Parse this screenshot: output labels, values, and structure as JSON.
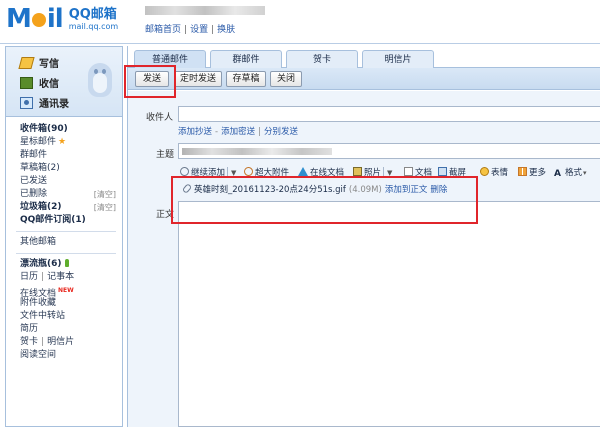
{
  "header": {
    "logo_m": "M",
    "logo_il": "il",
    "logo_cn": "QQ邮箱",
    "logo_domain": "mail.qq.com",
    "links": [
      "邮箱首页",
      "设置",
      "换肤"
    ],
    "link_sep": "|"
  },
  "sidebar": {
    "compose": [
      {
        "label": "写信",
        "icon": "pen-icon"
      },
      {
        "label": "收信",
        "icon": "inbox-icon"
      },
      {
        "label": "通讯录",
        "icon": "contacts-icon"
      }
    ],
    "folders": {
      "inbox": "收件箱(90)",
      "starred": "星标邮件",
      "group": "群邮件",
      "drafts": "草稿箱(2)",
      "sent": "已发送",
      "deleted": "已删除",
      "deleted_clear": "[清空]",
      "spam": "垃圾箱(2)",
      "spam_clear": "[清空]",
      "subscriptions": "QQ邮件订阅(1)",
      "other": "其他邮箱",
      "drift": "漂流瓶(6)",
      "calendar": "日历",
      "notes": "记事本",
      "docs": "在线文档",
      "docs_badge": "NEW",
      "favorites": "附件收藏",
      "transfer": "文件中转站",
      "resume": "简历",
      "greeting": "贺卡",
      "postcard": "明信片",
      "reading": "阅读空间"
    }
  },
  "tabs": [
    {
      "label": "普通邮件",
      "active": true
    },
    {
      "label": "群邮件",
      "active": false
    },
    {
      "label": "贺卡",
      "active": false
    },
    {
      "label": "明信片",
      "active": false
    }
  ],
  "toolbar": {
    "send": "发送",
    "schedule": "定时发送",
    "draft": "存草稿",
    "close": "关闭"
  },
  "form": {
    "to_label": "收件人",
    "to_value": "",
    "cc_links": [
      "添加抄送",
      "添加密送",
      "分别发送"
    ],
    "cc_sep1": "-",
    "cc_sep2": "|",
    "subject_label": "主题",
    "body_label": "正文"
  },
  "editor": {
    "attach": "继续添加",
    "big_attach": "超大附件",
    "online_doc": "在线文档",
    "photo": "照片",
    "document": "文档",
    "screenshot": "截屏",
    "emoji": "表情",
    "more": "更多",
    "format": "格式"
  },
  "attachment": {
    "filename": "英雄时刻_20161123-20点24分51s.gif",
    "size": "(4.09M)",
    "add_to_body": "添加到正文",
    "delete": "删除"
  },
  "colors": {
    "brand_blue": "#1e73c9",
    "annotation_red": "#e0252b"
  }
}
